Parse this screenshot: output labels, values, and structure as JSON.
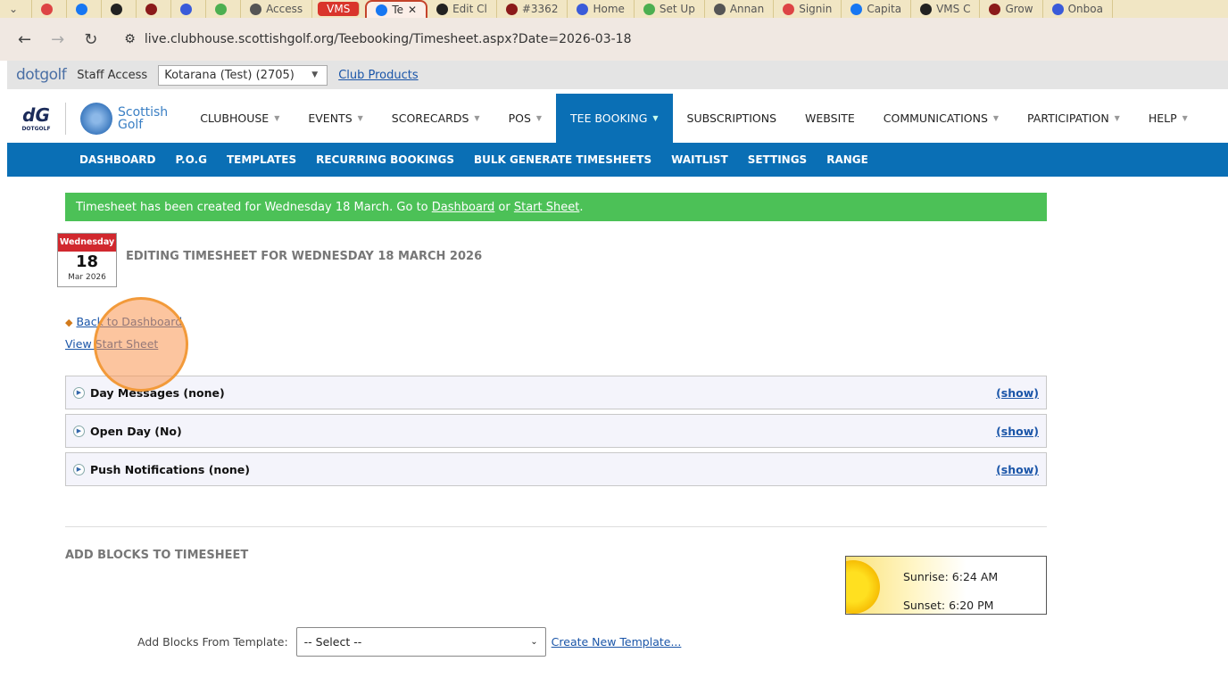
{
  "browser": {
    "tabs": [
      {
        "label": ""
      },
      {
        "label": ""
      },
      {
        "label": ""
      },
      {
        "label": ""
      },
      {
        "label": ""
      },
      {
        "label": ""
      },
      {
        "label": ""
      },
      {
        "label": "Access"
      },
      {
        "label": "VMS"
      },
      {
        "label": "Te"
      },
      {
        "label": "Edit Cl"
      },
      {
        "label": "#3362"
      },
      {
        "label": "Home"
      },
      {
        "label": "Set Up"
      },
      {
        "label": "Annan"
      },
      {
        "label": "Signin"
      },
      {
        "label": "Capita"
      },
      {
        "label": "VMS C"
      },
      {
        "label": "Grow"
      },
      {
        "label": "Onboa"
      }
    ],
    "url": "live.clubhouse.scottishgolf.org/Teebooking/Timesheet.aspx?Date=2026-03-18",
    "close": "✕"
  },
  "staffbar": {
    "logo": "dotgolf",
    "label": "Staff Access",
    "club": "Kotarana (Test) (2705)",
    "link": "Club Products"
  },
  "header": {
    "logo1": "DOTGOLF",
    "logo2_line1": "Scottish",
    "logo2_line2": "Golf",
    "nav": [
      {
        "label": "CLUBHOUSE",
        "dd": true
      },
      {
        "label": "EVENTS",
        "dd": true
      },
      {
        "label": "SCORECARDS",
        "dd": true
      },
      {
        "label": "POS",
        "dd": true
      },
      {
        "label": "TEE BOOKING",
        "dd": true,
        "active": true
      },
      {
        "label": "SUBSCRIPTIONS"
      },
      {
        "label": "WEBSITE"
      },
      {
        "label": "COMMUNICATIONS",
        "dd": true
      },
      {
        "label": "PARTICIPATION",
        "dd": true
      },
      {
        "label": "HELP",
        "dd": true
      }
    ]
  },
  "subnav": [
    "DASHBOARD",
    "P.O.G",
    "TEMPLATES",
    "RECURRING BOOKINGS",
    "BULK GENERATE TIMESHEETS",
    "WAITLIST",
    "SETTINGS",
    "RANGE"
  ],
  "alert": {
    "text": "Timesheet has been created for Wednesday 18 March. Go to ",
    "dashboard": "Dashboard",
    "or": " or ",
    "startsheet": "Start Sheet",
    "end": "."
  },
  "calendar": {
    "day": "Wednesday",
    "date": "18",
    "month": "Mar 2026"
  },
  "title": "EDITING TIMESHEET FOR WEDNESDAY 18 MARCH 2026",
  "links": {
    "back": "Back to Dashboard",
    "view": "View Start Sheet"
  },
  "panels": [
    {
      "label": "Day Messages (none)",
      "action": "(show)"
    },
    {
      "label": "Open Day (No)",
      "action": "(show)"
    },
    {
      "label": "Push Notifications (none)",
      "action": "(show)"
    }
  ],
  "add_blocks": {
    "heading": "ADD BLOCKS TO TIMESHEET",
    "template_label": "Add Blocks From Template:",
    "template_value": "-- Select --",
    "create": "Create New Template..."
  },
  "sun": {
    "sunrise": "Sunrise: 6:24 AM",
    "sunset": "Sunset: 6:20 PM"
  },
  "colors": {
    "primary": "#0a6fb5",
    "alert": "#4cc157",
    "calendar": "#d1282e"
  }
}
